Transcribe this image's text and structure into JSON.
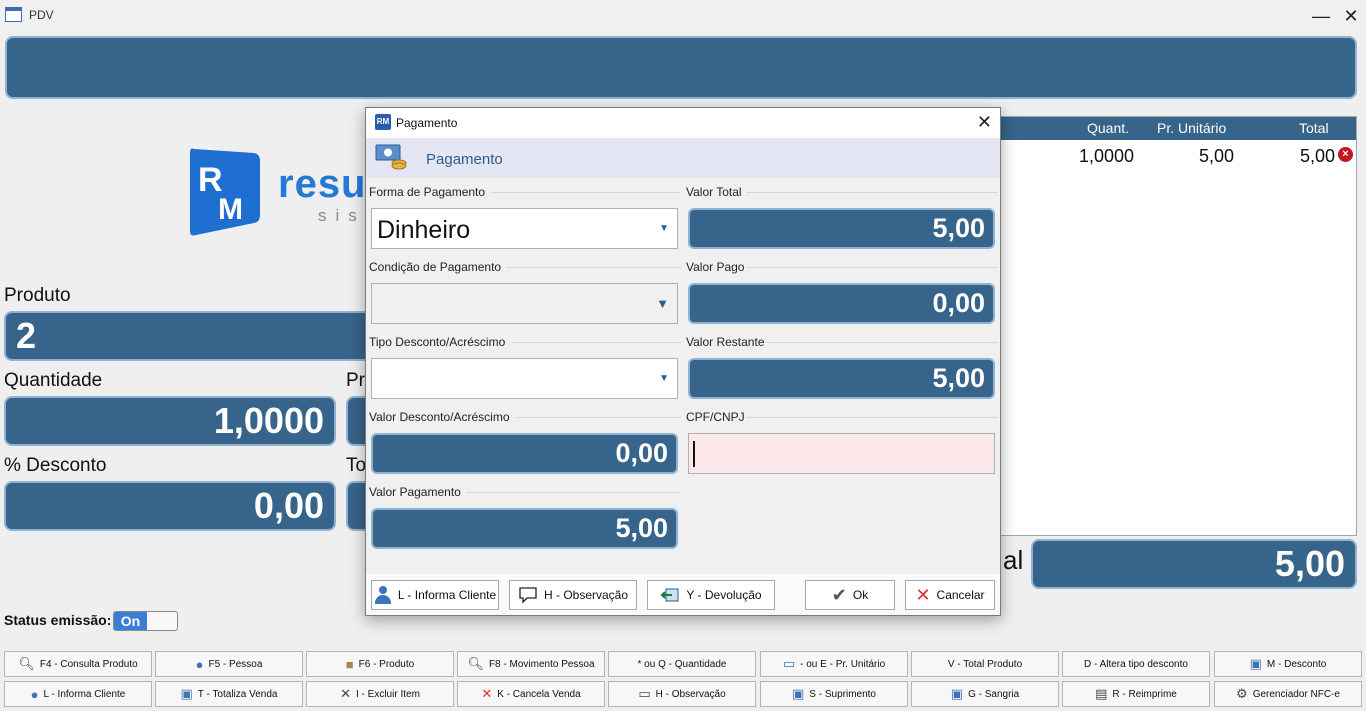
{
  "window": {
    "title": "PDV",
    "minimize": "—",
    "close": "✕"
  },
  "logo": {
    "text": "resu",
    "sub": "sis"
  },
  "main": {
    "produto_label": "Produto",
    "produto_value": "2",
    "quantidade_label": "Quantidade",
    "quantidade_value": "1,0000",
    "preco_label_partial": "Pr",
    "desconto_label": "% Desconto",
    "desconto_value": "0,00",
    "total_item_label_partial": "To",
    "total_label_partial": "al",
    "total_value": "5,00"
  },
  "items_table": {
    "headers": {
      "quant": "Quant.",
      "pr_unit": "Pr. Unitário",
      "total": "Total"
    },
    "rows": [
      {
        "quant": "1,0000",
        "pr_unit": "5,00",
        "total": "5,00"
      }
    ]
  },
  "status": {
    "label": "Status emissão:",
    "toggle": "On"
  },
  "toolbar": {
    "row1": [
      {
        "label": "F4 - Consulta Produto",
        "icon": "search-icon"
      },
      {
        "label": "F5 - Pessoa",
        "icon": "user-icon"
      },
      {
        "label": "F6 - Produto",
        "icon": "box-icon"
      },
      {
        "label": "F8 - Movimento Pessoa",
        "icon": "search-icon"
      },
      {
        "label": "* ou Q - Quantidade",
        "icon": ""
      },
      {
        "label": "- ou E - Pr. Unitário",
        "icon": "price-icon"
      },
      {
        "label": "V - Total Produto",
        "icon": ""
      },
      {
        "label": "D - Altera tipo desconto",
        "icon": ""
      },
      {
        "label": "M - Desconto",
        "icon": "money-icon"
      }
    ],
    "row2": [
      {
        "label": "L - Informa Cliente",
        "icon": "user-icon"
      },
      {
        "label": "T - Totaliza Venda",
        "icon": "money-icon"
      },
      {
        "label": "I - Excluir Item",
        "icon": "x-icon"
      },
      {
        "label": "K - Cancela Venda",
        "icon": "x-red-icon"
      },
      {
        "label": "H - Observação",
        "icon": "comment-icon"
      },
      {
        "label": "S - Suprimento",
        "icon": "money-icon"
      },
      {
        "label": "G - Sangria",
        "icon": "money-icon"
      },
      {
        "label": "R - Reimprime",
        "icon": "printer-icon"
      },
      {
        "label": "Gerenciador NFC-e",
        "icon": "gear-icon"
      }
    ]
  },
  "modal": {
    "title": "Pagamento",
    "close": "✕",
    "header": "Pagamento",
    "forma_label": "Forma de Pagamento",
    "forma_value": "Dinheiro",
    "condicao_label": "Condição de Pagamento",
    "condicao_value": "",
    "tipo_label": "Tipo Desconto/Acréscimo",
    "tipo_value": "",
    "valor_desc_label": "Valor Desconto/Acréscimo",
    "valor_desc_value": "0,00",
    "valor_pag_label": "Valor Pagamento",
    "valor_pag_value": "5,00",
    "valor_total_label": "Valor Total",
    "valor_total_value": "5,00",
    "valor_pago_label": "Valor Pago",
    "valor_pago_value": "0,00",
    "valor_rest_label": "Valor Restante",
    "valor_rest_value": "5,00",
    "cpf_label": "CPF/CNPJ",
    "cpf_value": "",
    "buttons": {
      "cliente": "L - Informa Cliente",
      "obs": "H - Observação",
      "dev": "Y - Devolução",
      "ok": "Ok",
      "cancel": "Cancelar"
    }
  }
}
